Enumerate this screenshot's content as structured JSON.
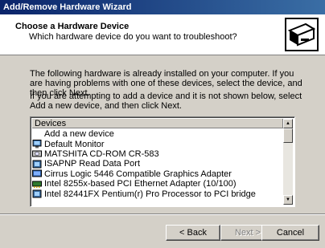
{
  "window": {
    "title": "Add/Remove Hardware Wizard"
  },
  "header": {
    "title": "Choose a Hardware Device",
    "subtitle": "Which hardware device do you want to troubleshoot?"
  },
  "body": {
    "intro": "The following hardware is already installed on your computer. If you are having problems with one of these devices, select the device, and then click Next.",
    "instruction": "If you are attempting to add a device and it is not shown below, select Add a new device, and then click Next."
  },
  "list": {
    "header": "Devices",
    "items": [
      {
        "label": "Add a new device",
        "icon": "none"
      },
      {
        "label": "Default Monitor",
        "icon": "monitor-icon"
      },
      {
        "label": "MATSHITA CD-ROM CR-583",
        "icon": "cdrom-icon"
      },
      {
        "label": "ISAPNP Read Data Port",
        "icon": "system-device-icon"
      },
      {
        "label": "Cirrus Logic 5446 Compatible Graphics Adapter",
        "icon": "display-adapter-icon"
      },
      {
        "label": "Intel 8255x-based PCI Ethernet Adapter (10/100)",
        "icon": "network-adapter-icon"
      },
      {
        "label": "Intel 82441FX Pentium(r) Pro Processor to PCI bridge",
        "icon": "system-device-icon"
      }
    ]
  },
  "buttons": {
    "back": "< Back",
    "next": "Next >",
    "cancel": "Cancel"
  },
  "colors": {
    "titlebar_start": "#0a246a",
    "titlebar_end": "#3a6ea5",
    "dialog_bg": "#d4d0c8"
  }
}
